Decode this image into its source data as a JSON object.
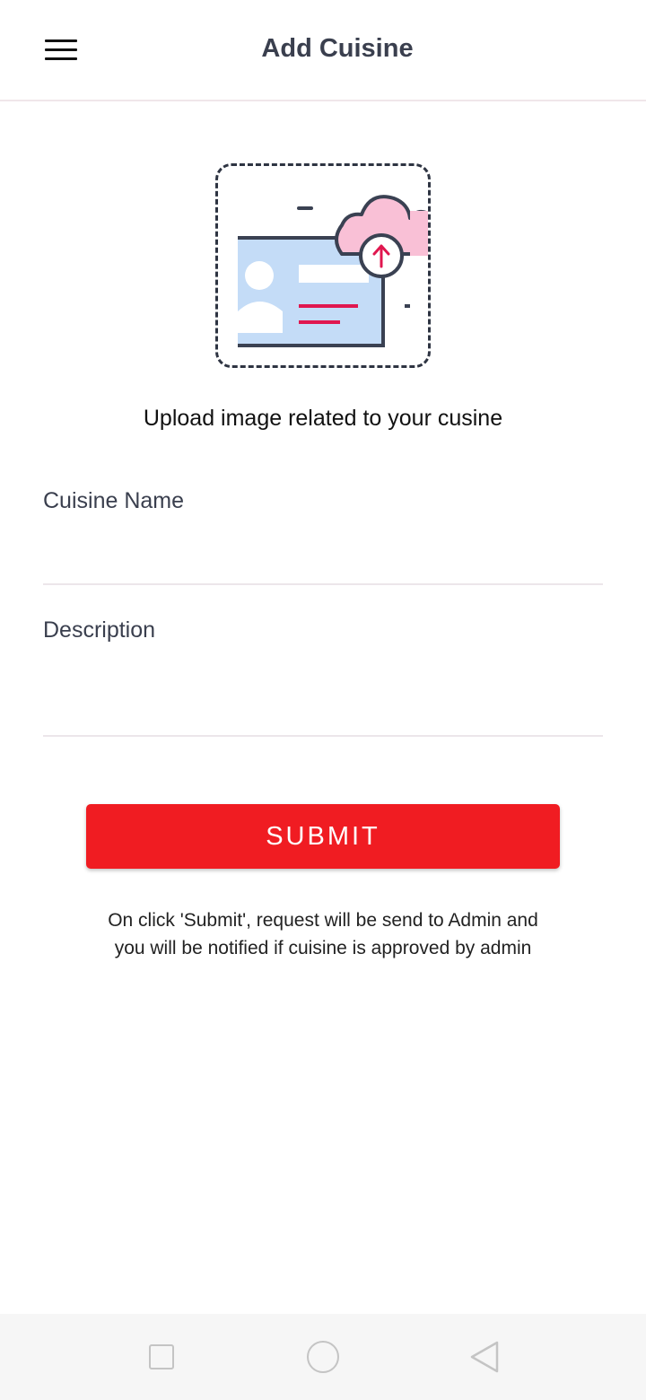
{
  "header": {
    "title": "Add Cuisine",
    "menu_icon": "hamburger-menu-icon"
  },
  "upload": {
    "icon": "upload-image-illustration",
    "caption": "Upload image related to your cusine"
  },
  "form": {
    "name_label": "Cuisine Name",
    "name_value": "",
    "description_label": "Description",
    "description_value": ""
  },
  "submit": {
    "label": "SUBMIT",
    "note": "On click 'Submit', request will be send to Admin and you will be notified if cuisine is approved by admin"
  },
  "system_nav": {
    "recent_icon": "square-recent-apps-icon",
    "home_icon": "circle-home-icon",
    "back_icon": "triangle-back-icon"
  },
  "colors": {
    "accent": "#f01c22",
    "title_text": "#3a3f4e",
    "divider": "#ece6ea",
    "illustration_blue": "#c4dcf7",
    "illustration_pink": "#f9c0d6",
    "illustration_red": "#e0174f"
  }
}
